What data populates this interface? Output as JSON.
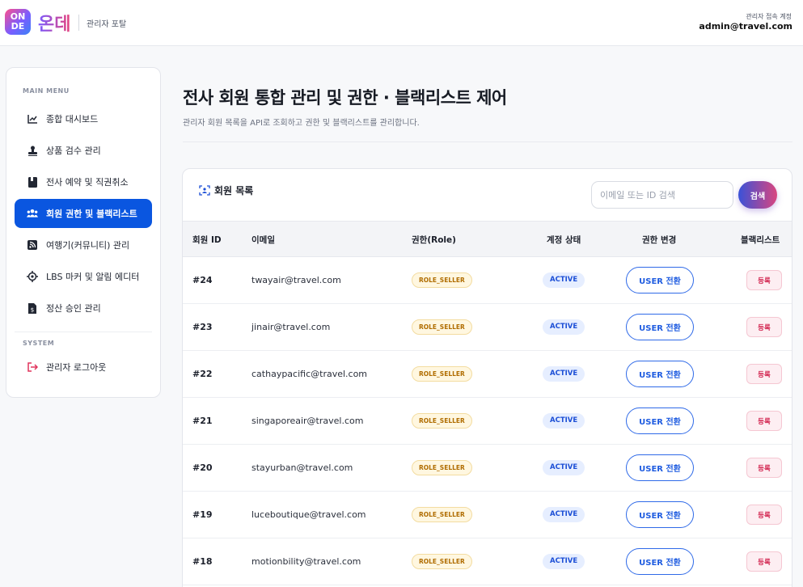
{
  "header": {
    "logo_line1": "ON",
    "logo_line2": "DE",
    "brand": "온데",
    "portal_label": "관리자 포탈",
    "account_caption": "관리자 접속 계정",
    "account_email": "admin@travel.com"
  },
  "sidebar": {
    "main_menu_label": "MAIN MENU",
    "system_label": "SYSTEM",
    "items": [
      {
        "label": "종합 대시보드",
        "icon": "chart-line-icon"
      },
      {
        "label": "상품 검수 관리",
        "icon": "stamp-icon"
      },
      {
        "label": "전사 예약 및 직권취소",
        "icon": "book-icon"
      },
      {
        "label": "회원 권한 및 블랙리스트",
        "icon": "users-icon",
        "active": true
      },
      {
        "label": "여행기(커뮤니티) 관리",
        "icon": "rss-icon"
      },
      {
        "label": "LBS 마커 및 알림 에디터",
        "icon": "crosshair-icon"
      },
      {
        "label": "정산 승인 관리",
        "icon": "invoice-icon"
      }
    ],
    "logout_label": "관리자 로그아웃"
  },
  "main": {
    "title": "전사 회원 통합 관리 및 권한 · 블랙리스트 제어",
    "subtitle": "관리자 회원 목록을 API로 조회하고 권한 및 블랙리스트를 관리합니다."
  },
  "panel": {
    "title": "회원 목록",
    "search_placeholder": "이메일 또는 ID 검색",
    "search_button": "검색",
    "columns": [
      "회원 ID",
      "이메일",
      "권한(Role)",
      "계정 상태",
      "권한 변경",
      "블랙리스트"
    ],
    "rows": [
      {
        "id": "#24",
        "email": "twayair@travel.com",
        "role": "ROLE_SELLER",
        "status": "ACTIVE",
        "action": "USER 전환",
        "blacklist": "등록"
      },
      {
        "id": "#23",
        "email": "jinair@travel.com",
        "role": "ROLE_SELLER",
        "status": "ACTIVE",
        "action": "USER 전환",
        "blacklist": "등록"
      },
      {
        "id": "#22",
        "email": "cathaypacific@travel.com",
        "role": "ROLE_SELLER",
        "status": "ACTIVE",
        "action": "USER 전환",
        "blacklist": "등록"
      },
      {
        "id": "#21",
        "email": "singaporeair@travel.com",
        "role": "ROLE_SELLER",
        "status": "ACTIVE",
        "action": "USER 전환",
        "blacklist": "등록"
      },
      {
        "id": "#20",
        "email": "stayurban@travel.com",
        "role": "ROLE_SELLER",
        "status": "ACTIVE",
        "action": "USER 전환",
        "blacklist": "등록"
      },
      {
        "id": "#19",
        "email": "luceboutique@travel.com",
        "role": "ROLE_SELLER",
        "status": "ACTIVE",
        "action": "USER 전환",
        "blacklist": "등록"
      },
      {
        "id": "#18",
        "email": "motionbility@travel.com",
        "role": "ROLE_SELLER",
        "status": "ACTIVE",
        "action": "USER 전환",
        "blacklist": "등록"
      }
    ]
  },
  "colors": {
    "accent": "#0a56e0",
    "role_badge": "#b06d00",
    "status_badge": "#1c4fd6",
    "blacklist": "#d2234e"
  }
}
